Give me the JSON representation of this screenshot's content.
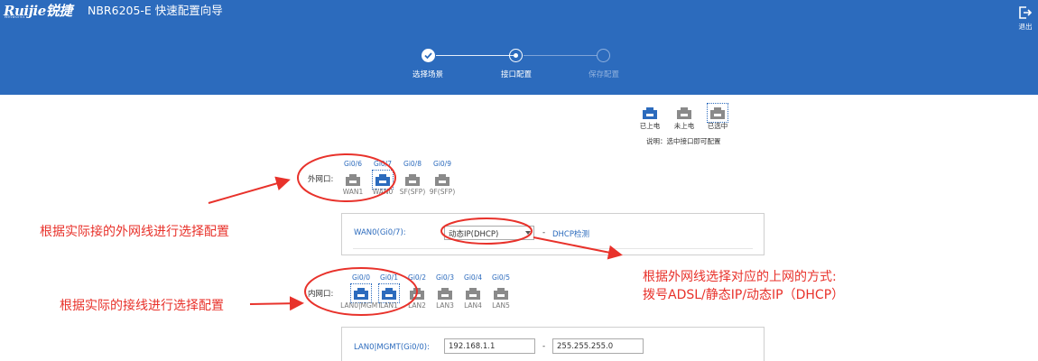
{
  "header": {
    "logo_text": "Ruijie锐捷",
    "logo_sub": "Networks",
    "title": "NBR6205-E  快速配置向导",
    "logout_label": "退出"
  },
  "wizard": {
    "steps": [
      {
        "label": "选择场景",
        "state": "done"
      },
      {
        "label": "接口配置",
        "state": "active"
      },
      {
        "label": "保存配置",
        "state": "pending"
      }
    ]
  },
  "legend": {
    "items": [
      {
        "label": "已上电",
        "status": "powered"
      },
      {
        "label": "未上电",
        "status": "unpowered"
      },
      {
        "label": "已选中",
        "status": "selected"
      }
    ],
    "note": "说明：选中接口即可配置"
  },
  "wan_ports": {
    "group_label": "外网口:",
    "ports": [
      {
        "name": "Gi0/6",
        "label": "WAN1",
        "status": "unpowered"
      },
      {
        "name": "Gi0/7",
        "label": "WAN0",
        "status": "selected"
      },
      {
        "name": "Gi0/8",
        "label": "SF(SFP)",
        "status": "unpowered"
      },
      {
        "name": "Gi0/9",
        "label": "9F(SFP)",
        "status": "unpowered"
      }
    ]
  },
  "wan_config": {
    "label": "WAN0(Gi0/7):",
    "mode_value": "动态IP(DHCP)",
    "separator": "-",
    "hint": "DHCP检测"
  },
  "lan_ports": {
    "group_label": "内网口:",
    "ports": [
      {
        "name": "Gi0/0",
        "label": "LAN0|MGMT",
        "status": "selected"
      },
      {
        "name": "Gi0/1",
        "label": "LAN1",
        "status": "selected"
      },
      {
        "name": "Gi0/2",
        "label": "LAN2",
        "status": "unpowered"
      },
      {
        "name": "Gi0/3",
        "label": "LAN3",
        "status": "unpowered"
      },
      {
        "name": "Gi0/4",
        "label": "LAN4",
        "status": "unpowered"
      },
      {
        "name": "Gi0/5",
        "label": "LAN5",
        "status": "unpowered"
      }
    ]
  },
  "lan_config": {
    "label": "LAN0|MGMT(Gi0/0):",
    "ip_value": "192.168.1.1",
    "separator": "-",
    "mask_value": "255.255.255.0"
  },
  "annotations": {
    "wan_note": "根据实际接的外网线进行选择配置",
    "lan_note": "根据实际的接线进行选择配置",
    "mode_note_line1": "根据外网线选择对应的上网的方式:",
    "mode_note_line2": "拨号ADSL/静态IP/动态IP（DHCP）"
  },
  "colors": {
    "header_bg": "#2c6bbd",
    "port_powered": "#2c6bbd",
    "port_unpowered": "#8a8a8a",
    "annotation_red": "#e8322b"
  }
}
